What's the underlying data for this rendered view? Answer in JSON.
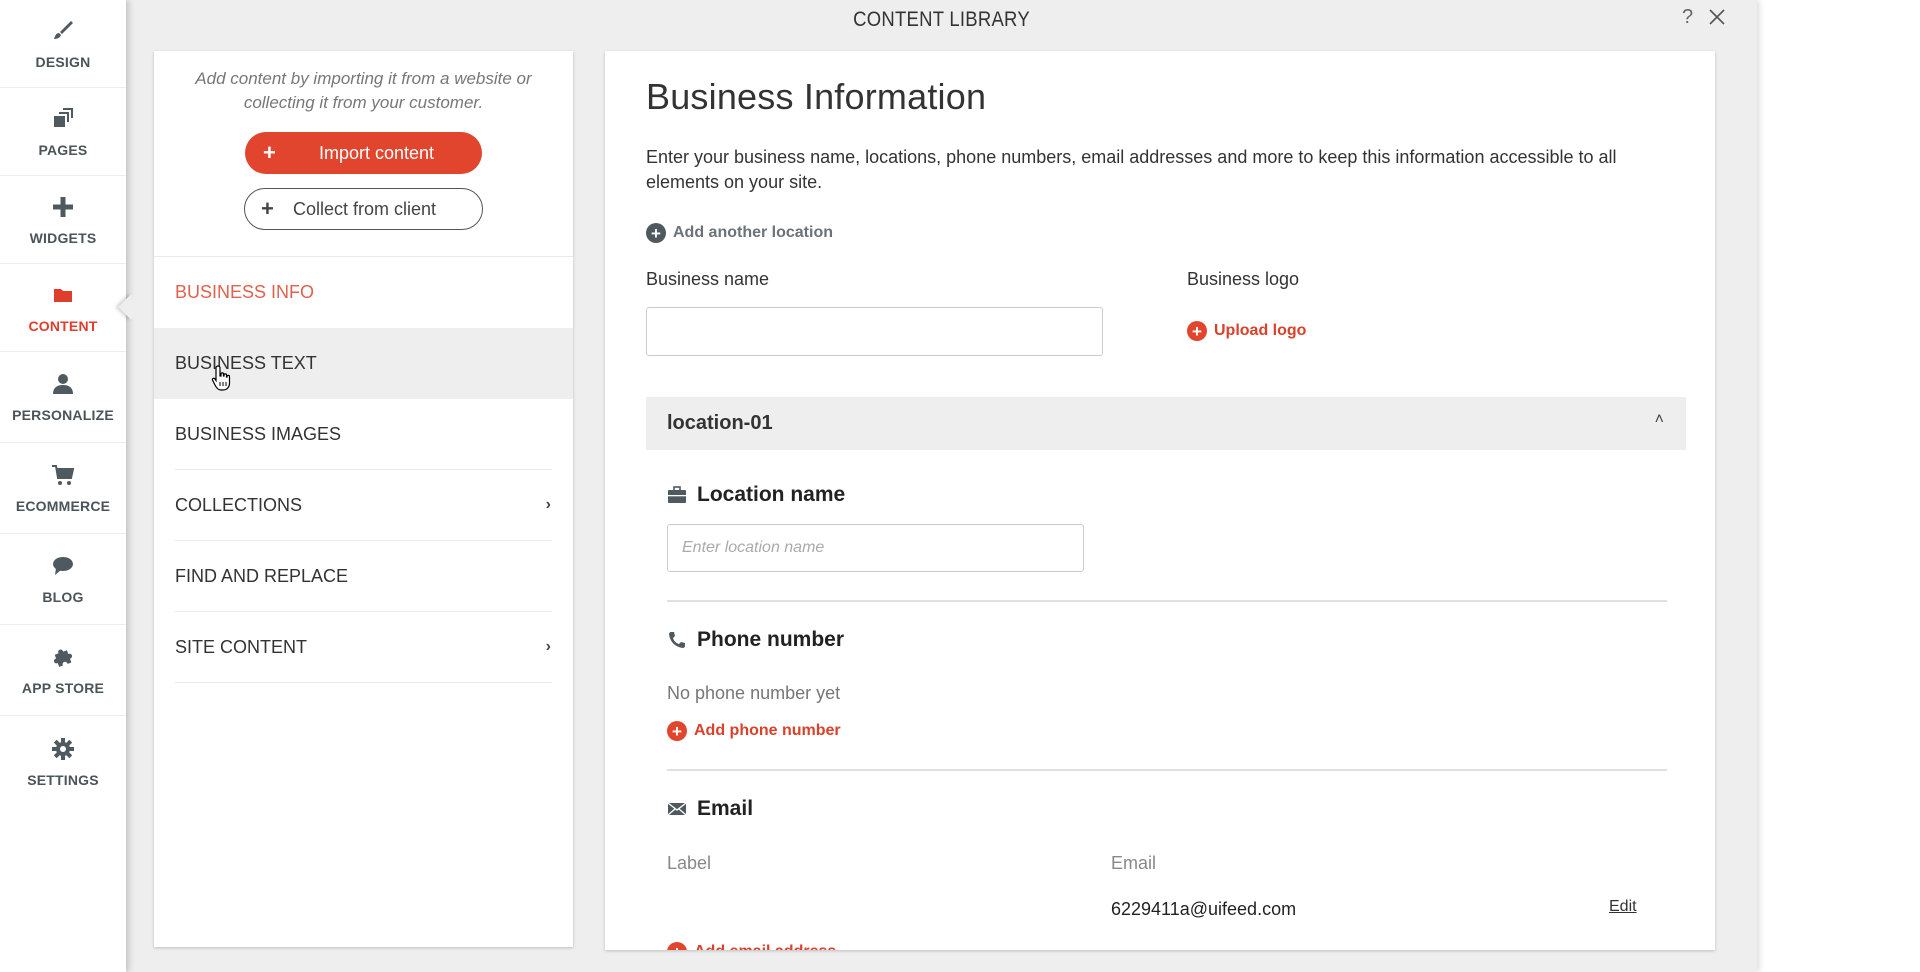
{
  "sidebar": {
    "items": [
      {
        "label": "DESIGN",
        "icon": "paintbrush-icon"
      },
      {
        "label": "PAGES",
        "icon": "pages-icon"
      },
      {
        "label": "WIDGETS",
        "icon": "plus-icon"
      },
      {
        "label": "CONTENT",
        "icon": "folder-icon",
        "active": true
      },
      {
        "label": "PERSONALIZE",
        "icon": "person-icon"
      },
      {
        "label": "ECOMMERCE",
        "icon": "cart-icon"
      },
      {
        "label": "BLOG",
        "icon": "speech-bubble-icon"
      },
      {
        "label": "APP STORE",
        "icon": "puzzle-icon"
      },
      {
        "label": "SETTINGS",
        "icon": "gear-icon"
      }
    ]
  },
  "modal": {
    "title": "CONTENT LIBRARY",
    "help_label": "?",
    "close_icon": "close-icon"
  },
  "left_panel": {
    "intro": "Add content by importing it from a website or collecting it from your customer.",
    "import_button": "Import content",
    "collect_button": "Collect from client",
    "nav": [
      {
        "label": "BUSINESS INFO",
        "active": true
      },
      {
        "label": "BUSINESS TEXT",
        "hover": true
      },
      {
        "label": "BUSINESS IMAGES"
      },
      {
        "label": "COLLECTIONS",
        "has_submenu": true
      },
      {
        "label": "FIND AND REPLACE"
      },
      {
        "label": "SITE CONTENT",
        "has_submenu": true
      }
    ]
  },
  "right_panel": {
    "title": "Business Information",
    "description": "Enter your business name, locations, phone numbers, email addresses and more to keep this information accessible to all elements on your site.",
    "add_location": "Add another location",
    "business_name_label": "Business name",
    "business_name_value": "",
    "business_logo_label": "Business logo",
    "upload_logo": "Upload logo",
    "location": {
      "name": "location-01",
      "expanded": true,
      "location_name_title": "Location name",
      "location_name_placeholder": "Enter location name",
      "location_name_value": "",
      "phone_title": "Phone number",
      "no_phone": "No phone number yet",
      "add_phone": "Add phone number",
      "email_title": "Email",
      "email_columns": {
        "label": "Label",
        "email": "Email"
      },
      "emails": [
        {
          "label": "",
          "email": "6229411a@uifeed.com",
          "action": "Edit"
        }
      ],
      "add_email": "Add email address"
    }
  },
  "colors": {
    "accent": "#e2452e",
    "active_nav": "#e0614d",
    "icon_grey": "#4f5a60",
    "modal_bg": "#eeeeee"
  }
}
